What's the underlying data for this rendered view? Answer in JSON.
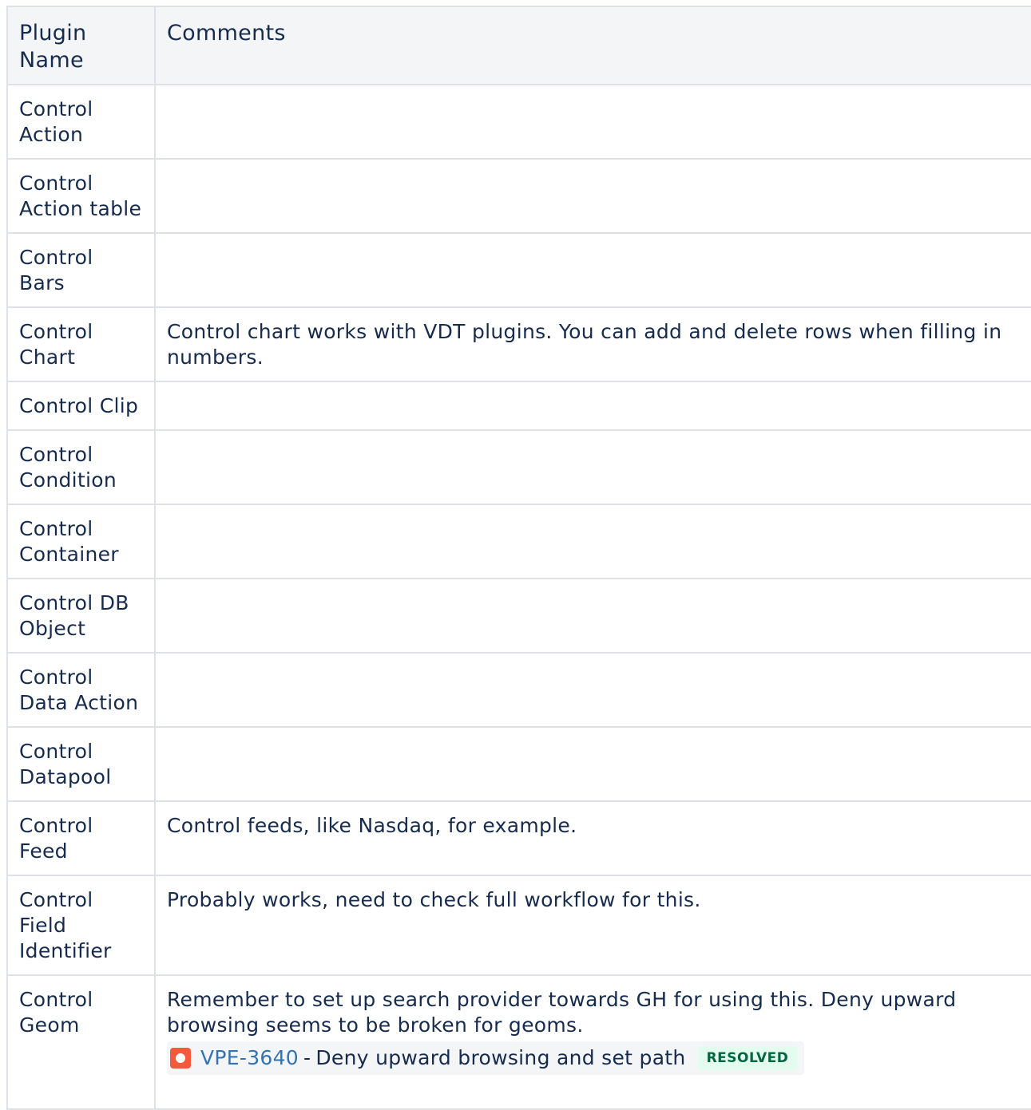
{
  "table": {
    "headers": {
      "plugin_name": "Plugin Name",
      "comments": "Comments"
    },
    "rows": [
      {
        "name": "Control Action",
        "comment": ""
      },
      {
        "name": "Control Action table",
        "comment": ""
      },
      {
        "name": "Control Bars",
        "comment": ""
      },
      {
        "name": "Control Chart",
        "comment": "Control chart works with VDT plugins. You can add and delete rows when filling in numbers."
      },
      {
        "name": "Control Clip",
        "comment": ""
      },
      {
        "name": "Control Condition",
        "comment": ""
      },
      {
        "name": "Control Container",
        "comment": ""
      },
      {
        "name": "Control DB Object",
        "comment": ""
      },
      {
        "name": "Control Data Action",
        "comment": ""
      },
      {
        "name": "Control Datapool",
        "comment": ""
      },
      {
        "name": "Control Feed",
        "comment": "Control feeds, like Nasdaq, for example."
      },
      {
        "name": "Control Field Identifier",
        "comment": "Probably works, need to check full workflow for this."
      },
      {
        "name": "Control Geom",
        "comment": "Remember to set up search provider towards GH for using this. Deny upward browsing seems to be broken for geoms."
      }
    ],
    "geom_issue": {
      "icon": "bug-icon",
      "key": "VPE-3640",
      "separator": "-",
      "summary": "Deny upward browsing and set path",
      "status": "RESOLVED",
      "icon_color": "#f15a3b",
      "status_color": "#006644"
    }
  }
}
